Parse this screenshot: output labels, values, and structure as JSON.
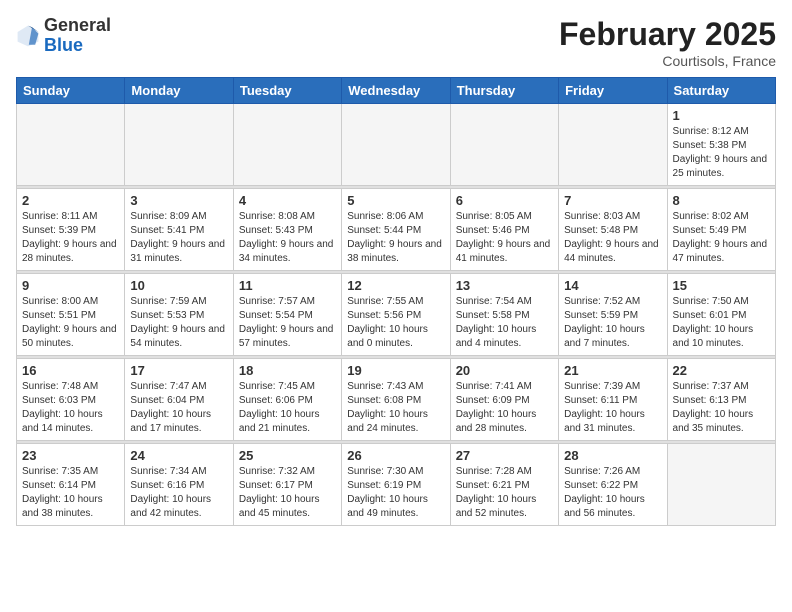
{
  "header": {
    "logo_general": "General",
    "logo_blue": "Blue",
    "month_title": "February 2025",
    "location": "Courtisols, France"
  },
  "days_of_week": [
    "Sunday",
    "Monday",
    "Tuesday",
    "Wednesday",
    "Thursday",
    "Friday",
    "Saturday"
  ],
  "weeks": [
    [
      {
        "day": "",
        "info": ""
      },
      {
        "day": "",
        "info": ""
      },
      {
        "day": "",
        "info": ""
      },
      {
        "day": "",
        "info": ""
      },
      {
        "day": "",
        "info": ""
      },
      {
        "day": "",
        "info": ""
      },
      {
        "day": "1",
        "info": "Sunrise: 8:12 AM\nSunset: 5:38 PM\nDaylight: 9 hours and 25 minutes."
      }
    ],
    [
      {
        "day": "2",
        "info": "Sunrise: 8:11 AM\nSunset: 5:39 PM\nDaylight: 9 hours and 28 minutes."
      },
      {
        "day": "3",
        "info": "Sunrise: 8:09 AM\nSunset: 5:41 PM\nDaylight: 9 hours and 31 minutes."
      },
      {
        "day": "4",
        "info": "Sunrise: 8:08 AM\nSunset: 5:43 PM\nDaylight: 9 hours and 34 minutes."
      },
      {
        "day": "5",
        "info": "Sunrise: 8:06 AM\nSunset: 5:44 PM\nDaylight: 9 hours and 38 minutes."
      },
      {
        "day": "6",
        "info": "Sunrise: 8:05 AM\nSunset: 5:46 PM\nDaylight: 9 hours and 41 minutes."
      },
      {
        "day": "7",
        "info": "Sunrise: 8:03 AM\nSunset: 5:48 PM\nDaylight: 9 hours and 44 minutes."
      },
      {
        "day": "8",
        "info": "Sunrise: 8:02 AM\nSunset: 5:49 PM\nDaylight: 9 hours and 47 minutes."
      }
    ],
    [
      {
        "day": "9",
        "info": "Sunrise: 8:00 AM\nSunset: 5:51 PM\nDaylight: 9 hours and 50 minutes."
      },
      {
        "day": "10",
        "info": "Sunrise: 7:59 AM\nSunset: 5:53 PM\nDaylight: 9 hours and 54 minutes."
      },
      {
        "day": "11",
        "info": "Sunrise: 7:57 AM\nSunset: 5:54 PM\nDaylight: 9 hours and 57 minutes."
      },
      {
        "day": "12",
        "info": "Sunrise: 7:55 AM\nSunset: 5:56 PM\nDaylight: 10 hours and 0 minutes."
      },
      {
        "day": "13",
        "info": "Sunrise: 7:54 AM\nSunset: 5:58 PM\nDaylight: 10 hours and 4 minutes."
      },
      {
        "day": "14",
        "info": "Sunrise: 7:52 AM\nSunset: 5:59 PM\nDaylight: 10 hours and 7 minutes."
      },
      {
        "day": "15",
        "info": "Sunrise: 7:50 AM\nSunset: 6:01 PM\nDaylight: 10 hours and 10 minutes."
      }
    ],
    [
      {
        "day": "16",
        "info": "Sunrise: 7:48 AM\nSunset: 6:03 PM\nDaylight: 10 hours and 14 minutes."
      },
      {
        "day": "17",
        "info": "Sunrise: 7:47 AM\nSunset: 6:04 PM\nDaylight: 10 hours and 17 minutes."
      },
      {
        "day": "18",
        "info": "Sunrise: 7:45 AM\nSunset: 6:06 PM\nDaylight: 10 hours and 21 minutes."
      },
      {
        "day": "19",
        "info": "Sunrise: 7:43 AM\nSunset: 6:08 PM\nDaylight: 10 hours and 24 minutes."
      },
      {
        "day": "20",
        "info": "Sunrise: 7:41 AM\nSunset: 6:09 PM\nDaylight: 10 hours and 28 minutes."
      },
      {
        "day": "21",
        "info": "Sunrise: 7:39 AM\nSunset: 6:11 PM\nDaylight: 10 hours and 31 minutes."
      },
      {
        "day": "22",
        "info": "Sunrise: 7:37 AM\nSunset: 6:13 PM\nDaylight: 10 hours and 35 minutes."
      }
    ],
    [
      {
        "day": "23",
        "info": "Sunrise: 7:35 AM\nSunset: 6:14 PM\nDaylight: 10 hours and 38 minutes."
      },
      {
        "day": "24",
        "info": "Sunrise: 7:34 AM\nSunset: 6:16 PM\nDaylight: 10 hours and 42 minutes."
      },
      {
        "day": "25",
        "info": "Sunrise: 7:32 AM\nSunset: 6:17 PM\nDaylight: 10 hours and 45 minutes."
      },
      {
        "day": "26",
        "info": "Sunrise: 7:30 AM\nSunset: 6:19 PM\nDaylight: 10 hours and 49 minutes."
      },
      {
        "day": "27",
        "info": "Sunrise: 7:28 AM\nSunset: 6:21 PM\nDaylight: 10 hours and 52 minutes."
      },
      {
        "day": "28",
        "info": "Sunrise: 7:26 AM\nSunset: 6:22 PM\nDaylight: 10 hours and 56 minutes."
      },
      {
        "day": "",
        "info": ""
      }
    ]
  ]
}
